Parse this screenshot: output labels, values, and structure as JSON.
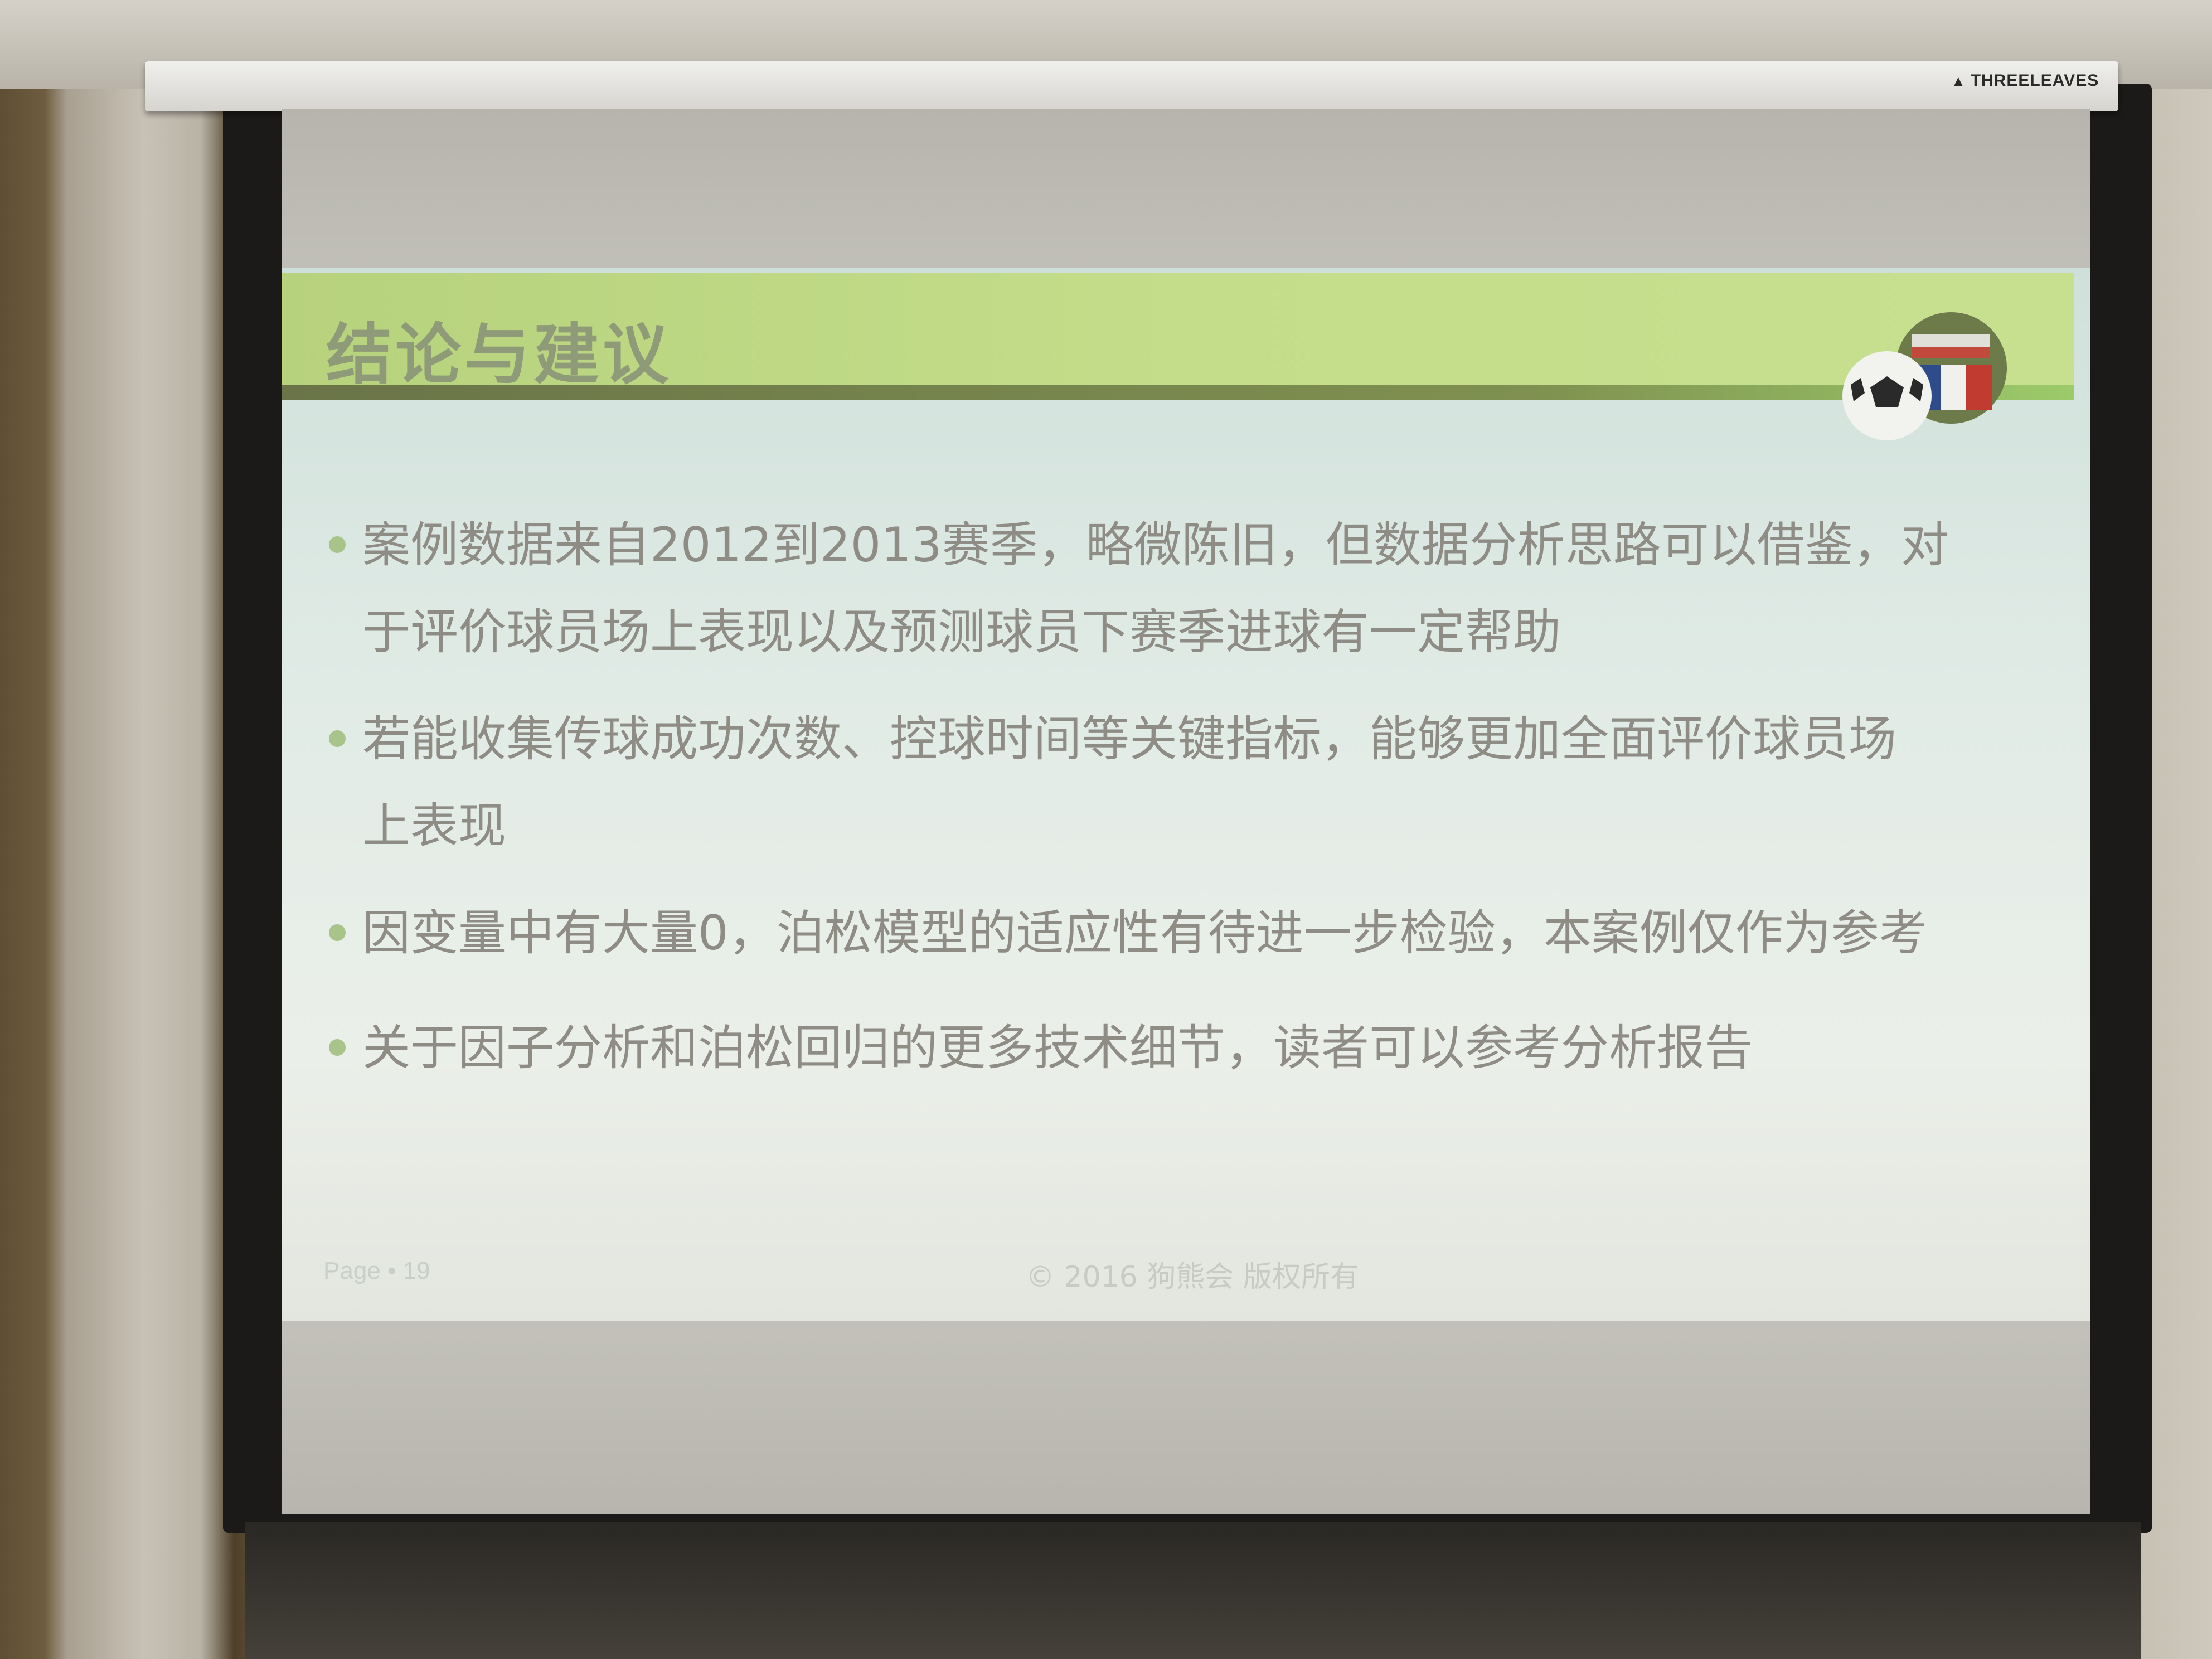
{
  "brand": "THREELEAVES",
  "slide": {
    "title": "结论与建议",
    "bullets": [
      {
        "line1": "案例数据来自2012到2013赛季，略微陈旧，但数据分析思路可以借鉴，对",
        "line2": "于评价球员场上表现以及预测球员下赛季进球有一定帮助"
      },
      {
        "line1": "若能收集传球成功次数、控球时间等关键指标，能够更加全面评价球员场",
        "line2": "上表现"
      },
      {
        "line1": "因变量中有大量0，泊松模型的适应性有待进一步检验，本案例仅作为参考"
      },
      {
        "line1": "关于因子分析和泊松回归的更多技术细节，读者可以参考分析报告"
      }
    ],
    "footer": {
      "page": "Page • 19",
      "copyright": "© 2016 狗熊会 版权所有"
    }
  }
}
